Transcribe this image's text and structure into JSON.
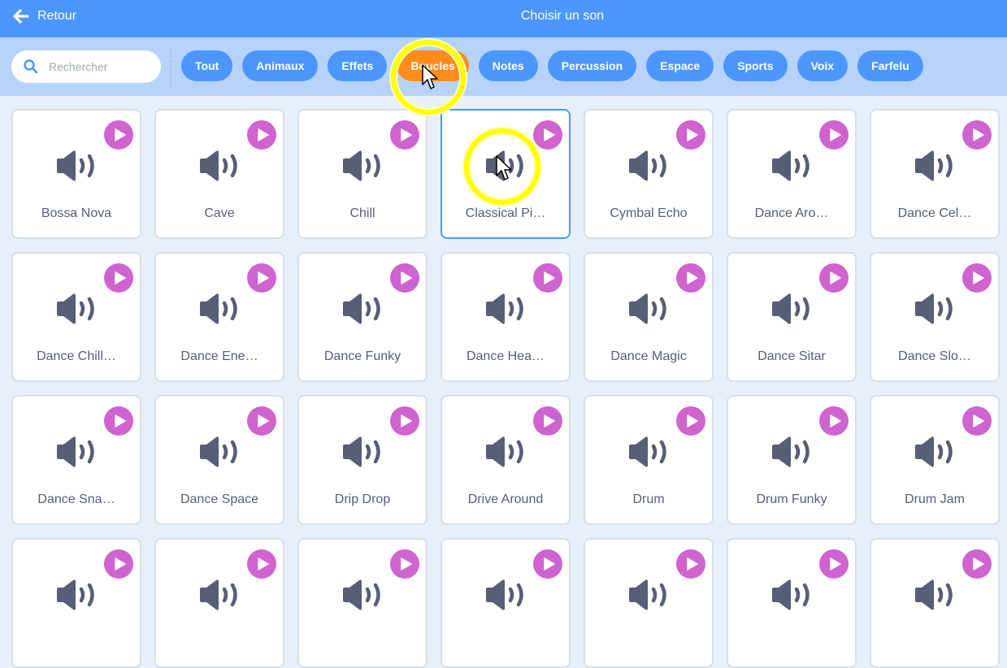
{
  "header": {
    "back_label": "Retour",
    "title": "Choisir un son"
  },
  "search": {
    "placeholder": "Rechercher",
    "value": ""
  },
  "tags": [
    {
      "label": "Tout",
      "active": false
    },
    {
      "label": "Animaux",
      "active": false
    },
    {
      "label": "Effets",
      "active": false
    },
    {
      "label": "Boucles",
      "active": true
    },
    {
      "label": "Notes",
      "active": false
    },
    {
      "label": "Percussion",
      "active": false
    },
    {
      "label": "Espace",
      "active": false
    },
    {
      "label": "Sports",
      "active": false
    },
    {
      "label": "Voix",
      "active": false
    },
    {
      "label": "Farfelu",
      "active": false
    }
  ],
  "sounds": [
    {
      "label": "Bossa Nova"
    },
    {
      "label": "Cave"
    },
    {
      "label": "Chill"
    },
    {
      "label": "Classical Pi…",
      "selected": true
    },
    {
      "label": "Cymbal Echo"
    },
    {
      "label": "Dance Aro…"
    },
    {
      "label": "Dance Cel…"
    },
    {
      "label": "Dance Chill…"
    },
    {
      "label": "Dance Ene…"
    },
    {
      "label": "Dance Funky"
    },
    {
      "label": "Dance Hea…"
    },
    {
      "label": "Dance Magic"
    },
    {
      "label": "Dance Sitar"
    },
    {
      "label": "Dance Slo…"
    },
    {
      "label": "Dance Sna…"
    },
    {
      "label": "Dance Space"
    },
    {
      "label": "Drip Drop"
    },
    {
      "label": "Drive Around"
    },
    {
      "label": "Drum"
    },
    {
      "label": "Drum Funky"
    },
    {
      "label": "Drum Jam"
    },
    {
      "label": ""
    },
    {
      "label": ""
    },
    {
      "label": ""
    },
    {
      "label": ""
    },
    {
      "label": ""
    },
    {
      "label": ""
    },
    {
      "label": ""
    }
  ],
  "colors": {
    "header": "#4c97ff",
    "filterbar": "#b8d3fa",
    "tag": "#4c97ff",
    "tag_active": "#ff8c1a",
    "play": "#cf63cf",
    "icon": "#575e75",
    "highlight": "#ffff00"
  },
  "icons": {
    "back": "arrow-left-icon",
    "search": "search-icon",
    "play": "play-icon",
    "sound": "speaker-icon"
  }
}
